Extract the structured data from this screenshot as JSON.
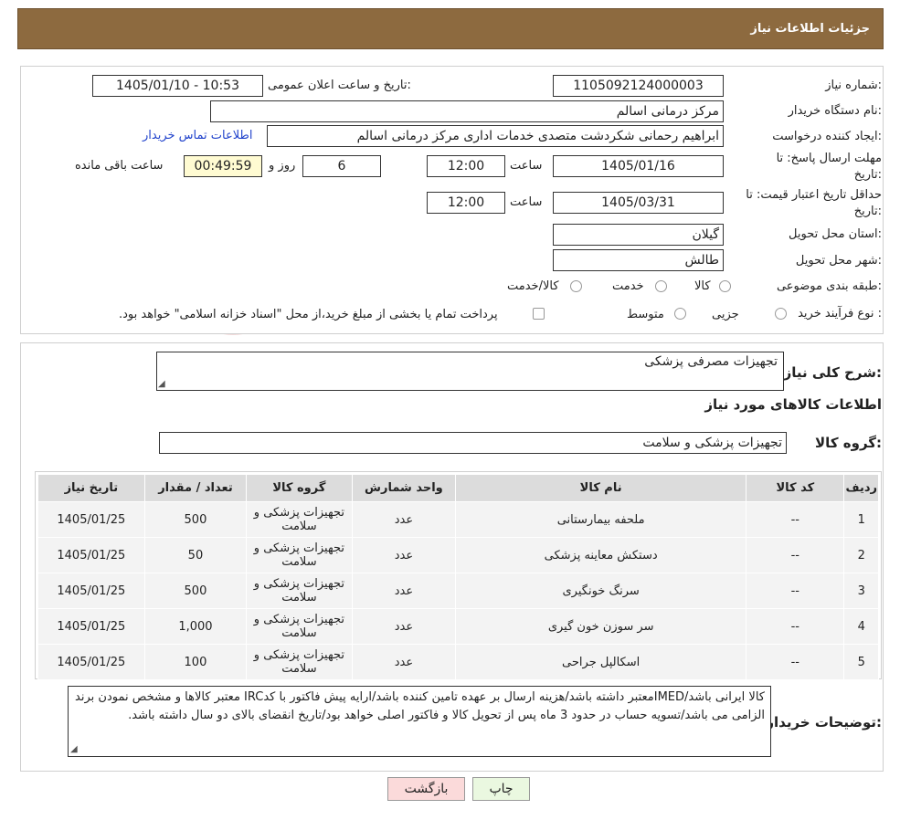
{
  "header": {
    "title": "جزئیات اطلاعات نیاز"
  },
  "watermark": {
    "text": "AriaTender.neT"
  },
  "form": {
    "need_number_label": "شماره نیاز:",
    "need_number": "1105092124000003",
    "announce_label": "تاریخ و ساعت اعلان عمومی:",
    "announce_value": "1405/01/10 - 10:53",
    "buyer_org_label": "نام دستگاه خریدار:",
    "buyer_org": "مرکز درمانی اسالم",
    "creator_label": "ایجاد کننده درخواست:",
    "creator": "ابراهیم رحمانی شکردشت متصدی خدمات اداری مرکز درمانی اسالم",
    "contact_link": "اطلاعات تماس خریدار",
    "reply_deadline_label_1": "مهلت ارسال پاسخ: تا",
    "reply_deadline_label_2": "تاریخ:",
    "reply_date": "1405/01/16",
    "time_label": "ساعت",
    "reply_time": "12:00",
    "days_value": "6",
    "days_label": "روز و",
    "remaining_time": "00:49:59",
    "remaining_label": "ساعت باقی مانده",
    "price_validity_label_1": "حداقل تاریخ اعتبار قیمت: تا",
    "price_validity_label_2": "تاریخ:",
    "price_validity_date": "1405/03/31",
    "price_validity_time": "12:00",
    "province_label": "استان محل تحویل:",
    "province": "گیلان",
    "city_label": "شهر محل تحویل:",
    "city": "طالش",
    "category_label": "طبقه بندی موضوعی:",
    "category_options": [
      "کالا",
      "خدمت",
      "کالا/خدمت"
    ],
    "process_label": "نوع فرآیند خرید :",
    "process_options": [
      "جزیی",
      "متوسط"
    ],
    "process_note": "پرداخت تمام یا بخشی از مبلغ خرید،از محل \"اسناد خزانه اسلامی\" خواهد بود."
  },
  "summary": {
    "desc_label": "شرح کلی نیاز:",
    "desc_value": "تجهیزات مصرفی پزشکی",
    "items_heading": "اطلاعات کالاهای مورد نیاز",
    "group_label": "گروه کالا:",
    "group_value": "تجهیزات پزشکی و سلامت"
  },
  "table": {
    "headers": [
      "ردیف",
      "کد کالا",
      "نام کالا",
      "واحد شمارش",
      "گروه کالا",
      "تعداد / مقدار",
      "تاریخ نیاز"
    ],
    "rows": [
      {
        "no": "1",
        "code": "--",
        "name": "ملحفه بیمارستانی",
        "unit": "عدد",
        "group": "تجهیزات پزشکی و سلامت",
        "qty": "500",
        "date": "1405/01/25"
      },
      {
        "no": "2",
        "code": "--",
        "name": "دستکش معاینه پزشکی",
        "unit": "عدد",
        "group": "تجهیزات پزشکی و سلامت",
        "qty": "50",
        "date": "1405/01/25"
      },
      {
        "no": "3",
        "code": "--",
        "name": "سرنگ خونگیری",
        "unit": "عدد",
        "group": "تجهیزات پزشکی و سلامت",
        "qty": "500",
        "date": "1405/01/25"
      },
      {
        "no": "4",
        "code": "--",
        "name": "سر سوزن خون گیری",
        "unit": "عدد",
        "group": "تجهیزات پزشکی و سلامت",
        "qty": "1,000",
        "date": "1405/01/25"
      },
      {
        "no": "5",
        "code": "--",
        "name": "اسکالپل جراحی",
        "unit": "عدد",
        "group": "تجهیزات پزشکی و سلامت",
        "qty": "100",
        "date": "1405/01/25"
      }
    ]
  },
  "notes": {
    "label": "توضیحات خریدار:",
    "text": "کالا ایرانی باشد/IMEDمعتبر داشته باشد/هزینه ارسال بر عهده تامین کننده باشد/ارایه پیش فاکتور با کدIRC معتبر کالاها و مشخص نمودن برند الزامی می باشد/تسویه حساب در حدود 3 ماه پس از تحویل کالا و فاکتور اصلی خواهد بود/تاریخ انقضای بالای دو سال داشته باشد."
  },
  "buttons": {
    "print": "چاپ",
    "back": "بازگشت"
  },
  "colors": {
    "header_bg": "#8d6a3f",
    "link": "#2244cc",
    "yellow_box": "#fffbd2",
    "back_button": "#fbdada",
    "print_button": "#eaf8e0"
  }
}
